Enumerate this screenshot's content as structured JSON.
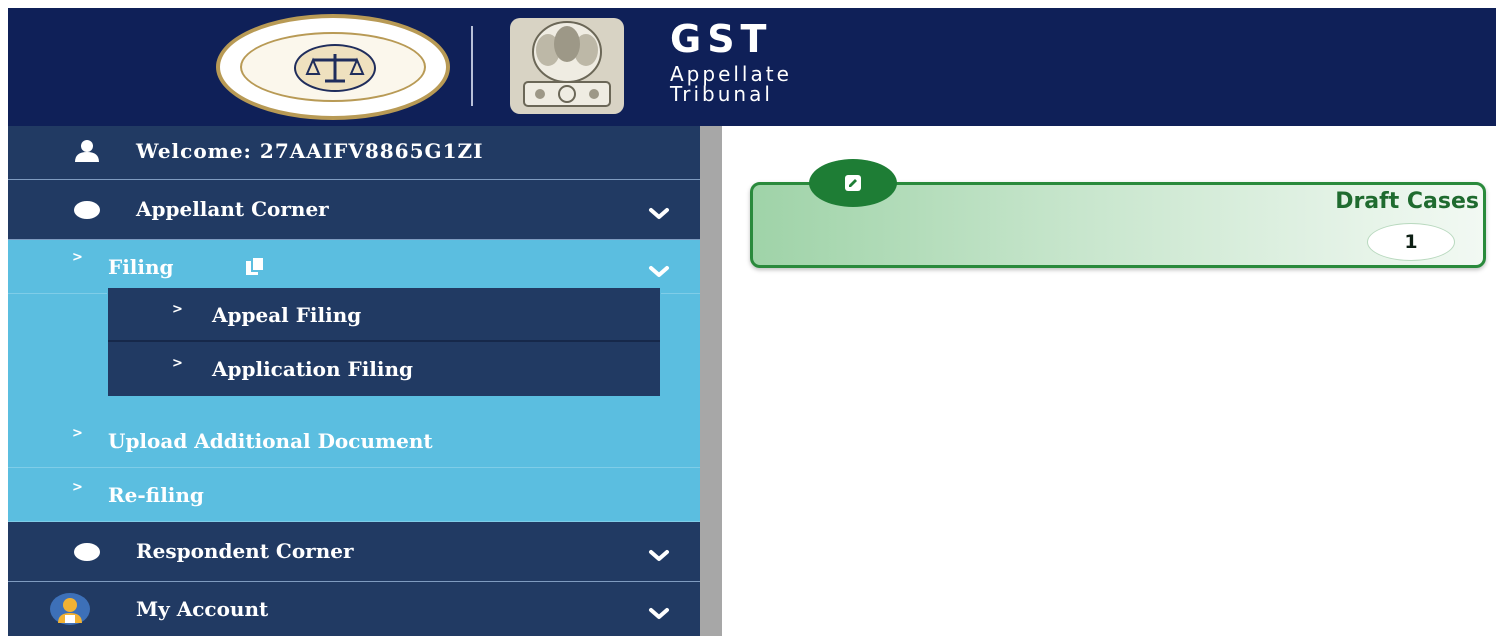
{
  "header": {
    "seal_text": "GST APPELLATE TRIBUNAL",
    "brand_title": "GST",
    "brand_line1": "Appellate",
    "brand_line2": "Tribunal"
  },
  "sidebar": {
    "welcome": "Welcome: 27AAIFV8865G1ZI",
    "appellant_corner": "Appellant Corner",
    "filing": "Filing",
    "filing_submenu": [
      "Appeal Filing",
      "Application Filing"
    ],
    "upload_additional_document": "Upload Additional Document",
    "refiling": "Re-filing",
    "respondent_corner": "Respondent Corner",
    "my_account": "My Account"
  },
  "main": {
    "draft_cases": {
      "title": "Draft Cases",
      "count": "1"
    }
  },
  "colors": {
    "header_bg": "#0f2058",
    "sidebar_dark": "#213a63",
    "sidebar_active": "#5bbee0",
    "card_green": "#2a8a3c"
  }
}
